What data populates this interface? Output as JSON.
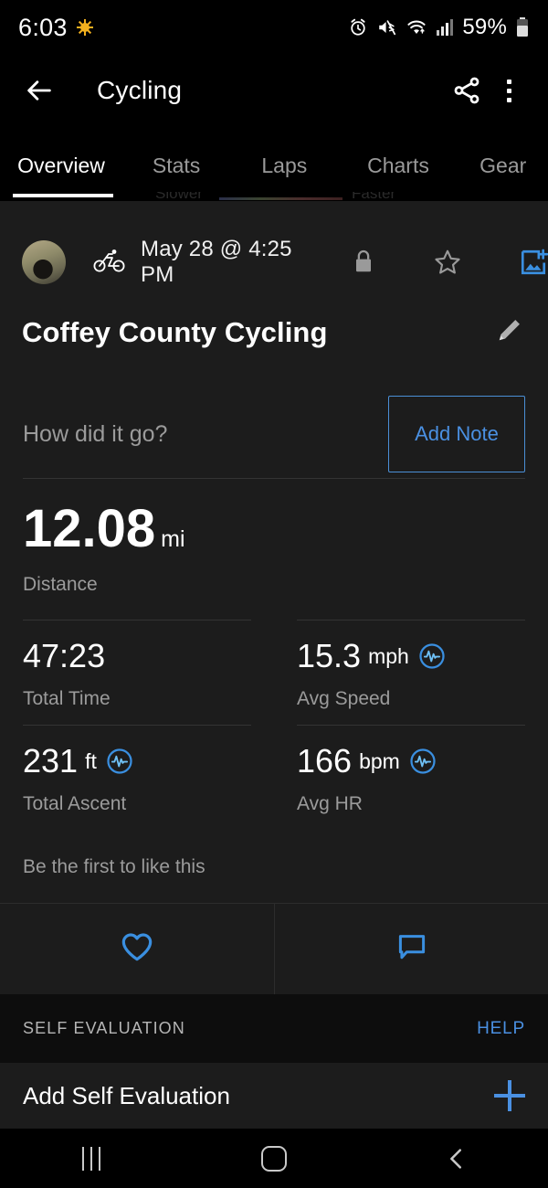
{
  "status_bar": {
    "time": "6:03",
    "weather_icon": "sun-icon",
    "icons": [
      "alarm-icon",
      "mute-icon",
      "wifi-icon",
      "cellular-signal-icon"
    ],
    "battery_percent": "59%"
  },
  "app_bar": {
    "back_icon": "back-arrow-icon",
    "title": "Cycling",
    "share_icon": "share-icon",
    "overflow_icon": "more-vertical-icon"
  },
  "tabs": {
    "items": [
      {
        "label": "Overview",
        "active": true
      },
      {
        "label": "Stats",
        "active": false
      },
      {
        "label": "Laps",
        "active": false
      },
      {
        "label": "Charts",
        "active": false
      },
      {
        "label": "Gear",
        "active": false
      }
    ]
  },
  "peek": {
    "left_label": "Slower",
    "right_label": "Faster"
  },
  "activity": {
    "avatar": "user-avatar",
    "sport_icon": "cycling-icon",
    "date": "May 28 @ 4:25 PM",
    "privacy_icon": "lock-icon",
    "favorite_icon": "star-outline-icon",
    "add_photo_icon": "add-photo-icon",
    "title": "Coffey County Cycling",
    "edit_icon": "pencil-icon",
    "note_prompt": "How did it go?",
    "add_note_label": "Add Note"
  },
  "primary_stat": {
    "value": "12.08",
    "unit": "mi",
    "label": "Distance"
  },
  "stats": [
    {
      "value": "47:23",
      "unit": "",
      "label": "Total Time",
      "graph_icon": false
    },
    {
      "value": "15.3",
      "unit": "mph",
      "label": "Avg Speed",
      "graph_icon": true
    },
    {
      "value": "231",
      "unit": "ft",
      "label": "Total Ascent",
      "graph_icon": true
    },
    {
      "value": "166",
      "unit": "bpm",
      "label": "Avg HR",
      "graph_icon": true
    }
  ],
  "social": {
    "like_text": "Be the first to like this",
    "like_icon": "heart-outline-icon",
    "comment_icon": "comment-icon"
  },
  "self_evaluation": {
    "section_title": "SELF EVALUATION",
    "help_label": "HELP",
    "add_label": "Add Self Evaluation",
    "add_icon": "plus-icon"
  },
  "nav_bar": {
    "recents_icon": "recents-icon",
    "home_icon": "home-icon",
    "back_icon": "back-chevron-icon"
  },
  "colors": {
    "accent": "#4a90e2",
    "background": "#000000",
    "surface": "#1c1c1c",
    "section_header": "#0d0d0d",
    "secondary_text": "#9b9b9b"
  }
}
